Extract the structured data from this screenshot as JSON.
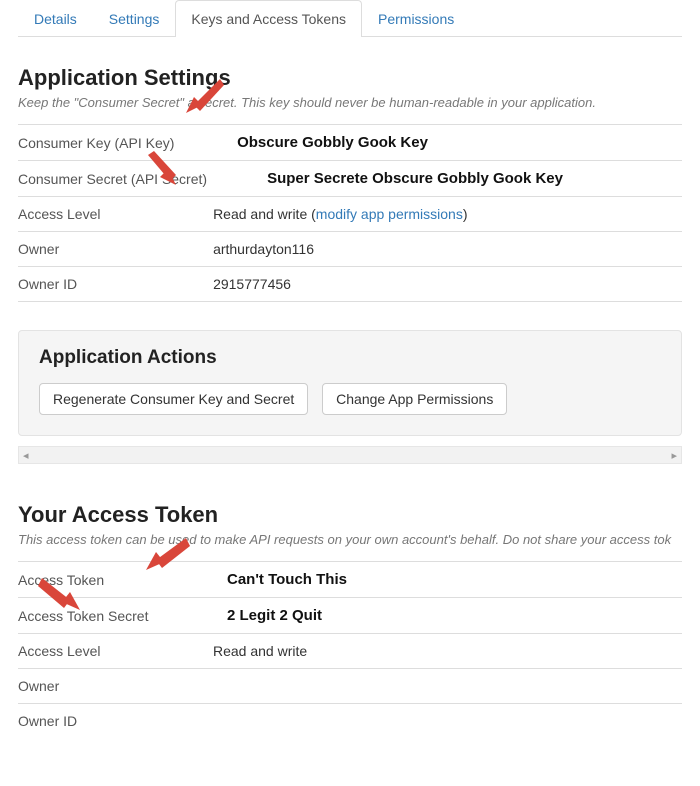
{
  "tabs": {
    "details": "Details",
    "settings": "Settings",
    "keys": "Keys and Access Tokens",
    "permissions": "Permissions"
  },
  "appSettings": {
    "heading": "Application Settings",
    "subtitle": "Keep the \"Consumer Secret\" a secret. This key should never be human-readable in your application.",
    "rows": {
      "consumerKey": {
        "label": "Consumer Key (API Key)",
        "value": "Obscure Gobbly Gook Key"
      },
      "consumerSecret": {
        "label": "Consumer Secret (API Secret)",
        "value": "Super Secrete Obscure Gobbly Gook Key"
      },
      "accessLevel": {
        "label": "Access Level",
        "prefix": "Read and write (",
        "link": "modify app permissions",
        "suffix": ")"
      },
      "owner": {
        "label": "Owner",
        "value": "arthurdayton116"
      },
      "ownerId": {
        "label": "Owner ID",
        "value": "2915777456"
      }
    }
  },
  "actions": {
    "heading": "Application Actions",
    "regenerate": "Regenerate Consumer Key and Secret",
    "changePerms": "Change App Permissions"
  },
  "accessToken": {
    "heading": "Your Access Token",
    "subtitle": "This access token can be used to make API requests on your own account's behalf. Do not share your access tok",
    "rows": {
      "token": {
        "label": "Access Token",
        "value": "Can't Touch This"
      },
      "tokenSecret": {
        "label": "Access Token Secret",
        "value": "2 Legit 2 Quit"
      },
      "accessLevel": {
        "label": "Access Level",
        "value": "Read and write"
      },
      "owner": {
        "label": "Owner",
        "value": ""
      },
      "ownerId": {
        "label": "Owner ID",
        "value": ""
      }
    }
  }
}
